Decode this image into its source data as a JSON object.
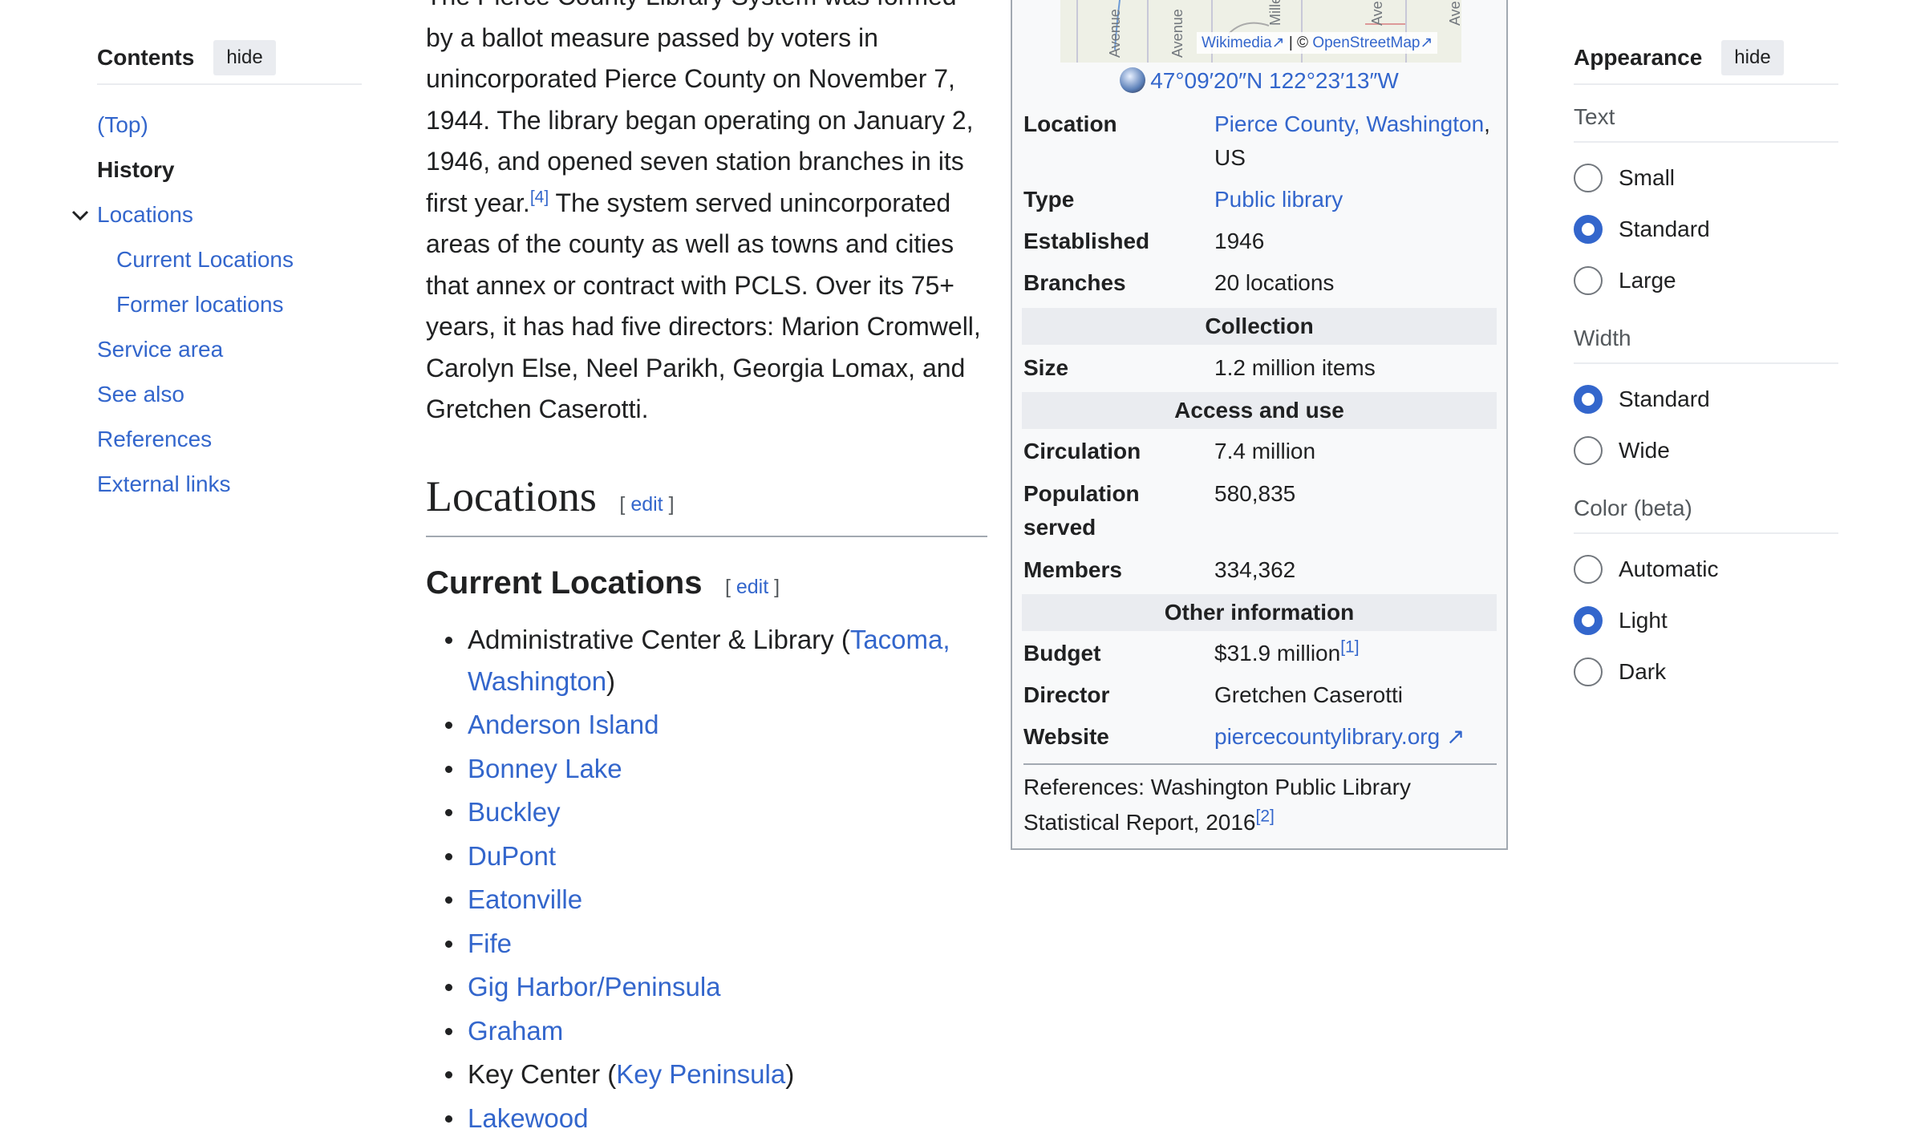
{
  "toc": {
    "title": "Contents",
    "hide_label": "hide",
    "items": [
      {
        "label": "(Top)"
      },
      {
        "label": "History"
      },
      {
        "label": "Locations"
      },
      {
        "label": "Current Locations"
      },
      {
        "label": "Former locations"
      },
      {
        "label": "Service area"
      },
      {
        "label": "See also"
      },
      {
        "label": "References"
      },
      {
        "label": "External links"
      }
    ]
  },
  "article": {
    "history_para": {
      "line0": "The Pierce County Library System was formed",
      "p1": "by a ballot measure passed by voters in unincorporated Pierce County on November 7, 1944. The library began operating on January 2, 1946, and opened seven station branches in its first year.",
      "ref": "[4]",
      "p2": " The system served unincorporated areas of the county as well as towns and cities that annex or contract with PCLS. Over its 75+ years, it has had five directors: Marion Cromwell, Carolyn Else, Neel Parikh, Georgia Lomax, and Gretchen Caserotti."
    },
    "locations_heading": "Locations",
    "current_heading": "Current Locations",
    "edit_label": "edit",
    "edit_open": "[",
    "edit_close": "]",
    "locations": [
      {
        "text_before": "Administrative Center & Library (",
        "link": "Tacoma, Washington",
        "text_after": ")"
      },
      {
        "text_before": "",
        "link": "Anderson Island",
        "text_after": ""
      },
      {
        "text_before": "",
        "link": "Bonney Lake",
        "text_after": ""
      },
      {
        "text_before": "",
        "link": "Buckley",
        "text_after": ""
      },
      {
        "text_before": "",
        "link": "DuPont",
        "text_after": ""
      },
      {
        "text_before": "",
        "link": "Eatonville",
        "text_after": ""
      },
      {
        "text_before": "",
        "link": "Fife",
        "text_after": ""
      },
      {
        "text_before": "",
        "link": "Gig Harbor/Peninsula",
        "text_after": ""
      },
      {
        "text_before": "",
        "link": "Graham",
        "text_after": ""
      },
      {
        "text_before": "Key Center (",
        "link": "Key Peninsula",
        "text_after": ")"
      },
      {
        "text_before": "",
        "link": "Lakewood",
        "text_after": ""
      }
    ]
  },
  "infobox": {
    "map_attribution_wikimedia": "Wikimedia",
    "map_attribution_sep": " | © ",
    "map_attribution_osm": "OpenStreetMap",
    "map_street_labels": [
      "Avenue",
      "Avenue",
      "Miller",
      "Avenue",
      "Avenue"
    ],
    "coordinates": "47°09′20″N 122°23′13″W",
    "rows": {
      "location_label": "Location",
      "location_link": "Pierce County, Washington",
      "location_suffix": ",",
      "location_line2": "US",
      "type_label": "Type",
      "type_value": "Public library",
      "established_label": "Established",
      "established_value": "1946",
      "branches_label": "Branches",
      "branches_value": "20 locations",
      "collection_header": "Collection",
      "size_label": "Size",
      "size_value": "1.2 million items",
      "access_header": "Access and use",
      "circulation_label": "Circulation",
      "circulation_value": "7.4 million",
      "population_label_1": "Population",
      "population_label_2": "served",
      "population_value": "580,835",
      "members_label": "Members",
      "members_value": "334,362",
      "other_header": "Other information",
      "budget_label": "Budget",
      "budget_value": "$31.9 million",
      "budget_ref": "[1]",
      "director_label": "Director",
      "director_value": "Gretchen Caserotti",
      "website_label": "Website",
      "website_value": "piercecountylibrary.org"
    },
    "references_text": "References: Washington Public Library Statistical Report, 2016",
    "references_ref": "[2]"
  },
  "appearance": {
    "title": "Appearance",
    "hide_label": "hide",
    "text_group": "Text",
    "text_options": [
      "Small",
      "Standard",
      "Large"
    ],
    "text_selected": "Standard",
    "width_group": "Width",
    "width_options": [
      "Standard",
      "Wide"
    ],
    "width_selected": "Standard",
    "color_group": "Color (beta)",
    "color_options": [
      "Automatic",
      "Light",
      "Dark"
    ],
    "color_selected": "Light"
  },
  "colors": {
    "link": "#3366cc",
    "text": "#202122",
    "infobox_bg": "#f8f9fa",
    "infobox_header_bg": "#eaecf0"
  },
  "icons": [
    "chevron-down-icon",
    "globe-icon",
    "external-link-icon"
  ]
}
